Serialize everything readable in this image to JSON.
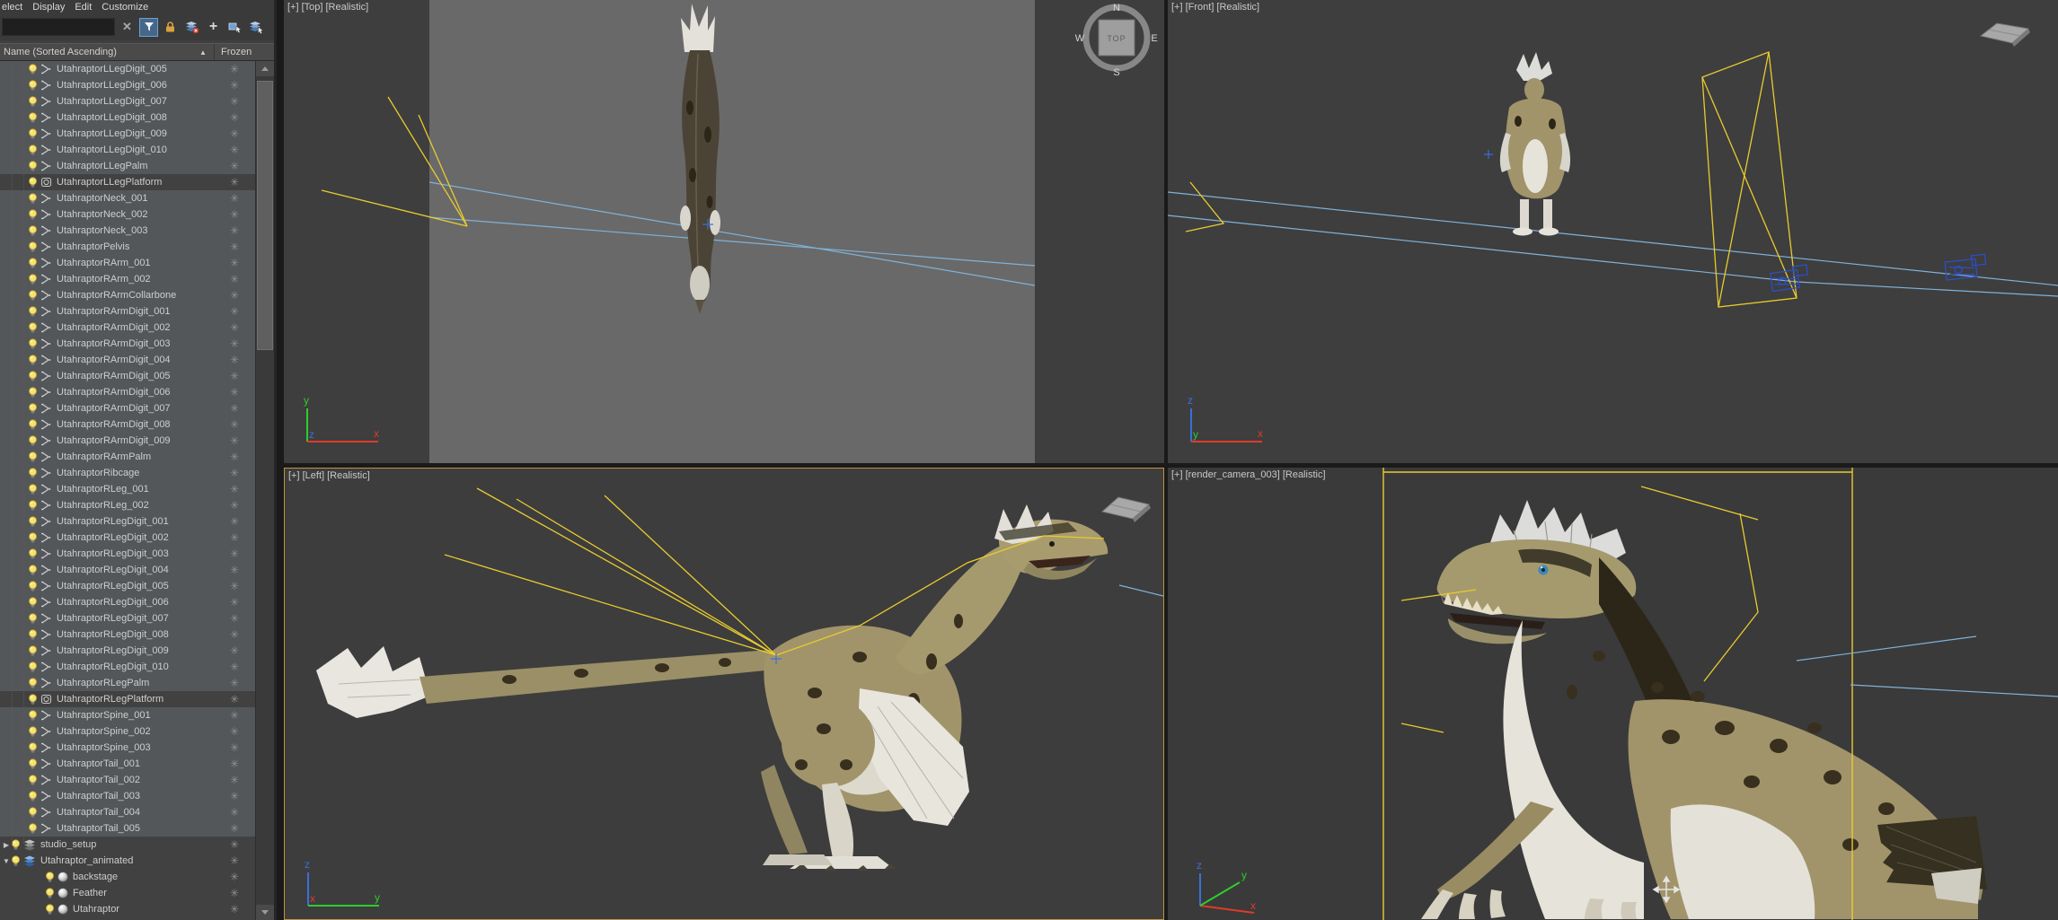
{
  "menu": {
    "items": [
      "elect",
      "Display",
      "Edit",
      "Customize"
    ]
  },
  "toolbar": {
    "search_value": "",
    "clear_glyph": "✕",
    "plus_glyph": "+"
  },
  "explorer": {
    "name_header": "Name (Sorted Ascending)",
    "sort_indicator": "▲",
    "frozen_header": "Frozen",
    "frozen_glyph": "✳",
    "collapsed_arrow": "▶",
    "expanded_arrow": "▼",
    "rows": [
      {
        "label": "UtahraptorLLegDigit_005",
        "type": "bone",
        "selected": true,
        "frozen": true
      },
      {
        "label": "UtahraptorLLegDigit_006",
        "type": "bone",
        "selected": true,
        "frozen": true
      },
      {
        "label": "UtahraptorLLegDigit_007",
        "type": "bone",
        "selected": true,
        "frozen": true
      },
      {
        "label": "UtahraptorLLegDigit_008",
        "type": "bone",
        "selected": true,
        "frozen": true
      },
      {
        "label": "UtahraptorLLegDigit_009",
        "type": "bone",
        "selected": true,
        "frozen": true
      },
      {
        "label": "UtahraptorLLegDigit_010",
        "type": "bone",
        "selected": true,
        "frozen": true
      },
      {
        "label": "UtahraptorLLegPalm",
        "type": "bone",
        "selected": true,
        "frozen": true
      },
      {
        "label": "UtahraptorLLegPlatform",
        "type": "dummy",
        "selected": false,
        "frozen": true
      },
      {
        "label": "UtahraptorNeck_001",
        "type": "bone",
        "selected": true,
        "frozen": true
      },
      {
        "label": "UtahraptorNeck_002",
        "type": "bone",
        "selected": true,
        "frozen": true
      },
      {
        "label": "UtahraptorNeck_003",
        "type": "bone",
        "selected": true,
        "frozen": true
      },
      {
        "label": "UtahraptorPelvis",
        "type": "bone",
        "selected": true,
        "frozen": true
      },
      {
        "label": "UtahraptorRArm_001",
        "type": "bone",
        "selected": true,
        "frozen": true
      },
      {
        "label": "UtahraptorRArm_002",
        "type": "bone",
        "selected": true,
        "frozen": true
      },
      {
        "label": "UtahraptorRArmCollarbone",
        "type": "bone",
        "selected": true,
        "frozen": true
      },
      {
        "label": "UtahraptorRArmDigit_001",
        "type": "bone",
        "selected": true,
        "frozen": true
      },
      {
        "label": "UtahraptorRArmDigit_002",
        "type": "bone",
        "selected": true,
        "frozen": true
      },
      {
        "label": "UtahraptorRArmDigit_003",
        "type": "bone",
        "selected": true,
        "frozen": true
      },
      {
        "label": "UtahraptorRArmDigit_004",
        "type": "bone",
        "selected": true,
        "frozen": true
      },
      {
        "label": "UtahraptorRArmDigit_005",
        "type": "bone",
        "selected": true,
        "frozen": true
      },
      {
        "label": "UtahraptorRArmDigit_006",
        "type": "bone",
        "selected": true,
        "frozen": true
      },
      {
        "label": "UtahraptorRArmDigit_007",
        "type": "bone",
        "selected": true,
        "frozen": true
      },
      {
        "label": "UtahraptorRArmDigit_008",
        "type": "bone",
        "selected": true,
        "frozen": true
      },
      {
        "label": "UtahraptorRArmDigit_009",
        "type": "bone",
        "selected": true,
        "frozen": true
      },
      {
        "label": "UtahraptorRArmPalm",
        "type": "bone",
        "selected": true,
        "frozen": true
      },
      {
        "label": "UtahraptorRibcage",
        "type": "bone",
        "selected": true,
        "frozen": true
      },
      {
        "label": "UtahraptorRLeg_001",
        "type": "bone",
        "selected": true,
        "frozen": true
      },
      {
        "label": "UtahraptorRLeg_002",
        "type": "bone",
        "selected": true,
        "frozen": true
      },
      {
        "label": "UtahraptorRLegDigit_001",
        "type": "bone",
        "selected": true,
        "frozen": true
      },
      {
        "label": "UtahraptorRLegDigit_002",
        "type": "bone",
        "selected": true,
        "frozen": true
      },
      {
        "label": "UtahraptorRLegDigit_003",
        "type": "bone",
        "selected": true,
        "frozen": true
      },
      {
        "label": "UtahraptorRLegDigit_004",
        "type": "bone",
        "selected": true,
        "frozen": true
      },
      {
        "label": "UtahraptorRLegDigit_005",
        "type": "bone",
        "selected": true,
        "frozen": true
      },
      {
        "label": "UtahraptorRLegDigit_006",
        "type": "bone",
        "selected": true,
        "frozen": true
      },
      {
        "label": "UtahraptorRLegDigit_007",
        "type": "bone",
        "selected": true,
        "frozen": true
      },
      {
        "label": "UtahraptorRLegDigit_008",
        "type": "bone",
        "selected": true,
        "frozen": true
      },
      {
        "label": "UtahraptorRLegDigit_009",
        "type": "bone",
        "selected": true,
        "frozen": true
      },
      {
        "label": "UtahraptorRLegDigit_010",
        "type": "bone",
        "selected": true,
        "frozen": true
      },
      {
        "label": "UtahraptorRLegPalm",
        "type": "bone",
        "selected": true,
        "frozen": true
      },
      {
        "label": "UtahraptorRLegPlatform",
        "type": "dummy",
        "selected": false,
        "frozen": true
      },
      {
        "label": "UtahraptorSpine_001",
        "type": "bone",
        "selected": true,
        "frozen": true
      },
      {
        "label": "UtahraptorSpine_002",
        "type": "bone",
        "selected": true,
        "frozen": true
      },
      {
        "label": "UtahraptorSpine_003",
        "type": "bone",
        "selected": true,
        "frozen": true
      },
      {
        "label": "UtahraptorTail_001",
        "type": "bone",
        "selected": true,
        "frozen": true
      },
      {
        "label": "UtahraptorTail_002",
        "type": "bone",
        "selected": true,
        "frozen": true
      },
      {
        "label": "UtahraptorTail_003",
        "type": "bone",
        "selected": true,
        "frozen": true
      },
      {
        "label": "UtahraptorTail_004",
        "type": "bone",
        "selected": true,
        "frozen": true
      },
      {
        "label": "UtahraptorTail_005",
        "type": "bone",
        "selected": true,
        "frozen": true
      },
      {
        "label": "studio_setup",
        "type": "layer_gray",
        "selected": false,
        "frozen": true,
        "arrow": "collapsed"
      },
      {
        "label": "Utahraptor_animated",
        "type": "layer_blue",
        "selected": false,
        "frozen": true,
        "arrow": "expanded"
      },
      {
        "label": "backstage",
        "type": "geometry",
        "selected": false,
        "frozen": true,
        "child": true
      },
      {
        "label": "Feather",
        "type": "geometry",
        "selected": false,
        "frozen": true,
        "child": true
      },
      {
        "label": "Utahraptor",
        "type": "geometry",
        "selected": false,
        "frozen": true,
        "child": true
      }
    ]
  },
  "viewports": {
    "top_left": {
      "label": "[+] [Top] [Realistic]"
    },
    "top_right": {
      "label": "[+] [Front] [Realistic]"
    },
    "bottom_left": {
      "label": "[+] [Left] [Realistic]"
    },
    "bottom_right": {
      "label": "[+] [render_camera_003] [Realistic]"
    },
    "viewcube": {
      "center": "TOP",
      "n": "N",
      "s": "S",
      "e": "E",
      "w": "W"
    },
    "axis": {
      "x": "x",
      "y": "y",
      "z": "z"
    }
  },
  "colors": {
    "selection_row": "#54575a",
    "active_viewport_border": "#bd9440",
    "wire_yellow": "#e9cb2e",
    "wire_cyan": "#7fb2d9",
    "camera_blue": "#2a4fd0",
    "bulb_yellow": "#f4e36e",
    "viewport_bg": "#3e3e3e",
    "top_floor": "#696969"
  }
}
